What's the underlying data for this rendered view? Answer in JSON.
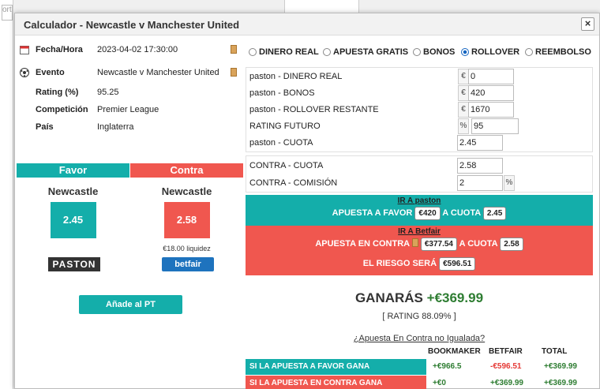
{
  "dialog": {
    "title": "Calculador - Newcastle v Manchester United",
    "close_label": "×"
  },
  "background": {
    "search_placeholder": "orte"
  },
  "event_info": {
    "fecha_label": "Fecha/Hora",
    "fecha_value": "2023-04-02 17:30:00",
    "evento_label": "Evento",
    "evento_value": "Newcastle v Manchester United",
    "rating_label": "Rating (%)",
    "rating_value": "95.25",
    "competicion_label": "Competición",
    "competicion_value": "Premier League",
    "pais_label": "País",
    "pais_value": "Inglaterra"
  },
  "favor": {
    "header": "Favor",
    "team": "Newcastle",
    "odds": "2.45",
    "logo": "PASTON"
  },
  "contra": {
    "header": "Contra",
    "team": "Newcastle",
    "odds": "2.58",
    "liquidity": "€18.00 liquidez",
    "logo": "betfair"
  },
  "add_button": "Añade al PT",
  "bet_types": [
    {
      "label": "DINERO REAL",
      "selected": false
    },
    {
      "label": "APUESTA GRATIS",
      "selected": false
    },
    {
      "label": "BONOS",
      "selected": false
    },
    {
      "label": "ROLLOVER",
      "selected": true
    },
    {
      "label": "REEMBOLSO",
      "selected": false
    }
  ],
  "fields": {
    "dinero_real_label": "paston - DINERO REAL",
    "dinero_real_value": "0",
    "bonos_label": "paston - BONOS",
    "bonos_value": "420",
    "rollover_label": "paston - ROLLOVER RESTANTE",
    "rollover_value": "1670",
    "rating_futuro_label": "RATING FUTURO",
    "rating_futuro_value": "95",
    "cuota_label": "paston - CUOTA",
    "cuota_value": "2.45",
    "contra_cuota_label": "CONTRA - CUOTA",
    "contra_cuota_value": "2.58",
    "contra_comision_label": "CONTRA - COMISIÓN",
    "contra_comision_value": "2",
    "currency": "€",
    "percent": "%"
  },
  "favor_band": {
    "link": "IR A paston",
    "text": "APUESTA A FAVOR",
    "stake": "€420",
    "odds_text": "A CUOTA",
    "odds": "2.45"
  },
  "contra_band": {
    "link": "IR A Betfair",
    "text": "APUESTA EN CONTRA",
    "stake": "€377.54",
    "odds_text": "A CUOTA",
    "odds": "2.58",
    "risk_text": "EL RIESGO SERÁ",
    "risk": "€596.51"
  },
  "result": {
    "win_label": "GANARÁS",
    "win_value": "+€369.99",
    "rating": "[ RATING 88.09% ]",
    "unmatched_link": "¿Apuesta En Contra no Igualada?"
  },
  "outcome_table": {
    "headers": [
      "BOOKMAKER",
      "BETFAIR",
      "TOTAL"
    ],
    "rows": [
      {
        "label": "SI LA APUESTA A FAVOR GANA",
        "bookmaker": "+€966.5",
        "betfair": "-€596.51",
        "total": "+€369.99"
      },
      {
        "label": "SI LA APUESTA EN CONTRA GANA",
        "bookmaker": "+€0",
        "betfair": "+€369.99",
        "total": "+€369.99"
      }
    ]
  },
  "colors": {
    "teal": "#14aeaa",
    "coral": "#f0574f"
  }
}
